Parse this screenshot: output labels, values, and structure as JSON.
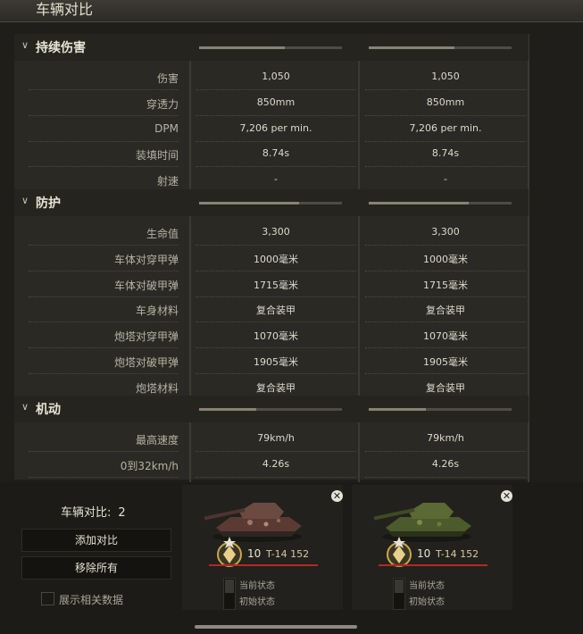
{
  "window": {
    "title": "车辆对比"
  },
  "sections": [
    {
      "title": "持续伤害",
      "bars": [
        0.6,
        0.6
      ],
      "rows": [
        {
          "label": "伤害",
          "values": [
            "1,050",
            "1,050"
          ]
        },
        {
          "label": "穿透力",
          "values": [
            "850mm",
            "850mm"
          ]
        },
        {
          "label": "DPM",
          "values": [
            "7,206 per min.",
            "7,206 per min."
          ]
        },
        {
          "label": "装填时间",
          "values": [
            "8.74s",
            "8.74s"
          ]
        },
        {
          "label": "射速",
          "values": [
            "-",
            "-"
          ]
        }
      ]
    },
    {
      "title": "防护",
      "bars": [
        0.7,
        0.7
      ],
      "rows": [
        {
          "label": "生命值",
          "values": [
            "3,300",
            "3,300"
          ]
        },
        {
          "label": "车体对穿甲弹",
          "values": [
            "1000毫米",
            "1000毫米"
          ]
        },
        {
          "label": "车体对破甲弹",
          "values": [
            "1715毫米",
            "1715毫米"
          ]
        },
        {
          "label": "车身材料",
          "values": [
            "复合装甲",
            "复合装甲"
          ]
        },
        {
          "label": "炮塔对穿甲弹",
          "values": [
            "1070毫米",
            "1070毫米"
          ]
        },
        {
          "label": "炮塔对破甲弹",
          "values": [
            "1905毫米",
            "1905毫米"
          ]
        },
        {
          "label": "炮塔材料",
          "values": [
            "复合装甲",
            "复合装甲"
          ]
        }
      ]
    },
    {
      "title": "机动",
      "bars": [
        0.4,
        0.4
      ],
      "rows": [
        {
          "label": "最高速度",
          "values": [
            "79km/h",
            "79km/h"
          ]
        },
        {
          "label": "0到32km/h",
          "values": [
            "4.26s",
            "4.26s"
          ]
        }
      ]
    }
  ],
  "compare": {
    "label": "车辆对比:",
    "count": "2",
    "add_button": "添加对比",
    "remove_button": "移除所有",
    "show_data_label": "展示相关数据"
  },
  "vehicles": [
    {
      "tier": "10",
      "name": "T-14 152",
      "state_current": "当前状态",
      "state_initial": "初始状态",
      "camo": "desert"
    },
    {
      "tier": "10",
      "name": "T-14 152",
      "state_current": "当前状态",
      "state_initial": "初始状态",
      "camo": "green"
    }
  ],
  "colors": {
    "accent_red": "#b42a23",
    "gold": "#c9a84a"
  }
}
